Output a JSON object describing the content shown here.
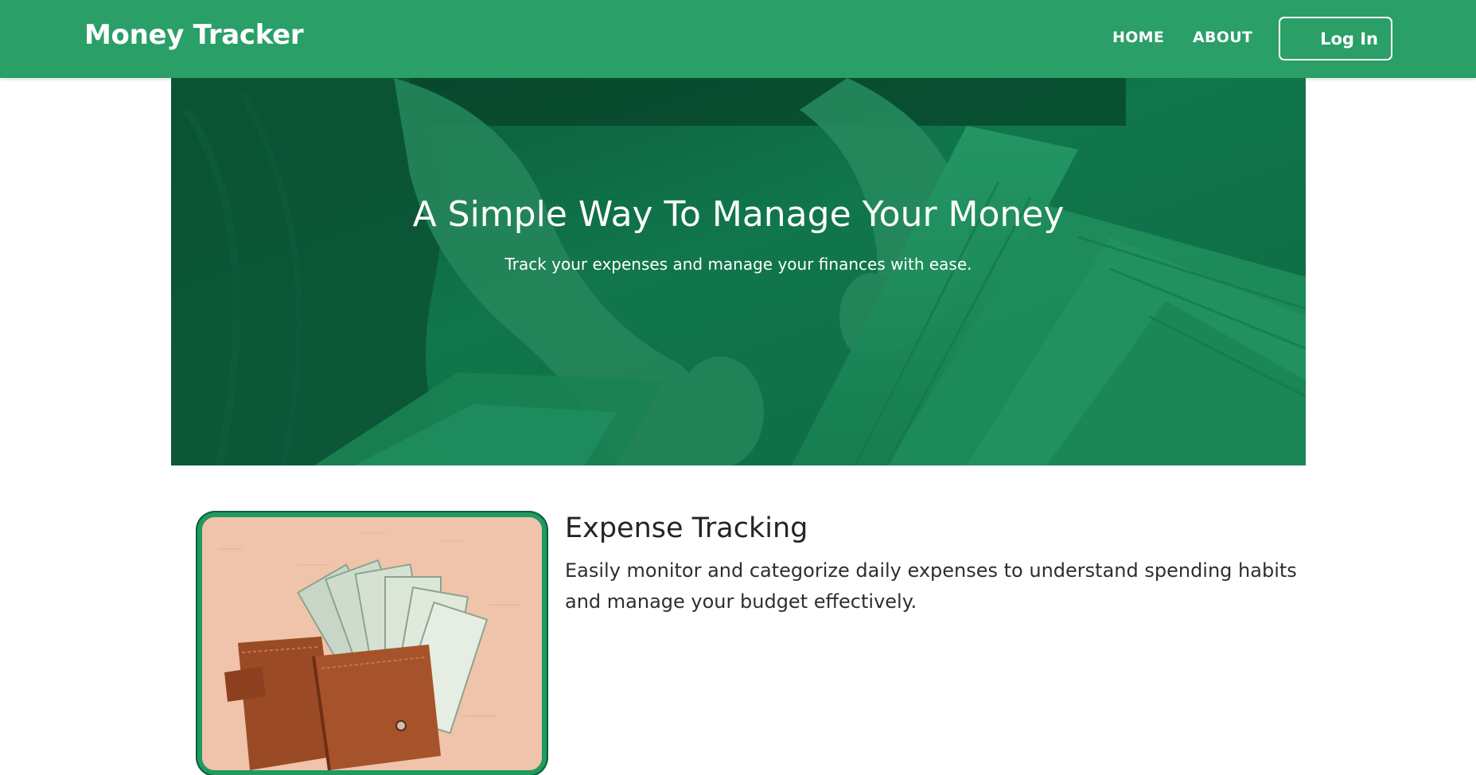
{
  "navbar": {
    "brand": "Money Tracker",
    "links": [
      {
        "label": "HOME"
      },
      {
        "label": "ABOUT"
      }
    ],
    "login_label": "Log In",
    "background_color": "#2a9f68"
  },
  "hero": {
    "title": "A Simple Way To Manage Your Money",
    "subtitle": "Track your expenses and manage your finances with ease.",
    "overlay_color": "#0f6a45"
  },
  "features": [
    {
      "title": "Expense Tracking",
      "description": "Easily monitor and categorize daily expenses to understand spending habits and manage your budget effectively.",
      "frame_color": "#1f9a60"
    }
  ]
}
